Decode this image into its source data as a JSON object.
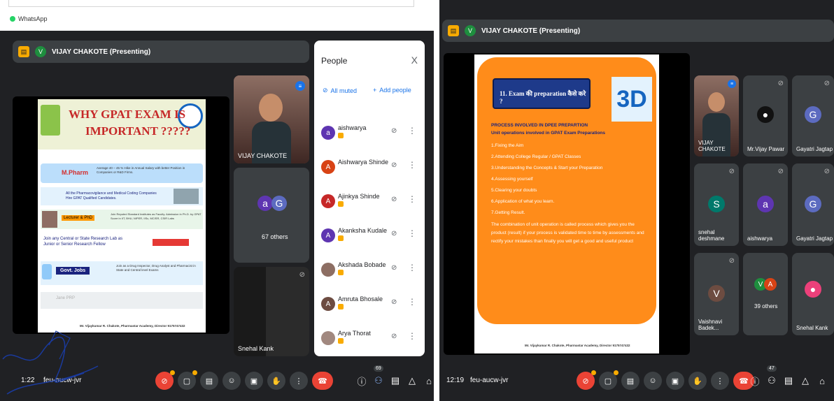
{
  "left": {
    "app": "WhatsApp",
    "presenting": "VIJAY CHAKOTE (Presenting)",
    "presenter_initial": "V",
    "slide": {
      "title_line1": "WHY GPAT EXAM IS",
      "title_line2": "IMPORTANT ?????",
      "mpharm_label": "M.Pharm",
      "mpharm_text": "Average 40 – 45 % Hike in Annual Salary with better Position in Companies or R&D Firms.",
      "pharmacovigilance": "All the Pharmacovigilance and Medical Coding Companies Hire GPAT Qualified Candidates.",
      "phd_label": "Lecturer & PhD",
      "phd_text": "Join Reputed Standard Institutes as Faculty. Admission in Ph.D. by GPAT Score in IIT, BHU, NIPER, IISc, MCISR, CSIR Labs",
      "research": "Join any Central or State Research Lab as Junior or Senior Research Fellow",
      "govt_label": "Govt. Jobs",
      "govt_text": "Join as a Drug Inspector, Drug Analyst and Pharmacist in State and Central level Exams",
      "faded": "Jane PRP",
      "footer": "Mr. Vijaykumar R. Chakote, Pharmastar Academy, Director 9175747432"
    },
    "presenter_tile_name": "VIJAY CHAKOTE",
    "others_label": "67 others",
    "others_avatars": [
      "a",
      "G"
    ],
    "snehal_tile": "Snehal Kank",
    "people": {
      "title": "People",
      "close": "X",
      "all_muted": "All muted",
      "add_people": "Add people",
      "list": [
        {
          "name": "aishwarya",
          "initial": "a",
          "color": "#5e35b1"
        },
        {
          "name": "Aishwarya Shinde",
          "initial": "A",
          "color": "#d84315"
        },
        {
          "name": "Ajinkya Shinde",
          "initial": "A",
          "color": "#c62828"
        },
        {
          "name": "Akanksha Kudale",
          "initial": "A",
          "color": "#5e35b1"
        },
        {
          "name": "Akshada Bobade",
          "initial": "",
          "color": "#8d6e63"
        },
        {
          "name": "Amruta Bhosale",
          "initial": "A",
          "color": "#6d4c41"
        },
        {
          "name": "Arya Thorat",
          "initial": "",
          "color": "#a1887f"
        }
      ]
    },
    "time": "1:22",
    "meeting_code": "feu-aucw-jvr",
    "participants_badge": "69"
  },
  "right": {
    "presenting": "VIJAY CHAKOTE (Presenting)",
    "presenter_initial": "V",
    "slide": {
      "heading": "11. Exam की preparation कैसे करे ?",
      "process_title": "PROCESS INVOLVED IN DPEE PREPARTION",
      "unit_ops": "Unit operations involved in GPAT Exam Preparations",
      "steps": [
        "1.Fixing the Aim",
        "2.Attending College Regular / GPAT Classes",
        "3.Understanding the Concepts & Start your Preparation",
        "4.Assessing yourself",
        "5.Clearing your doubts",
        "6.Application of what you learn.",
        "7.Getting Result."
      ],
      "summary": "The combination of unit operation is called process which gives you the product (result) if your process is validated time to time by assessments and rectify your mistakes than finally you will get a good and useful product",
      "footer": "Mr. Vijaykumar R. Chakote, Pharmastar Academy, Director 9175747432"
    },
    "tiles": [
      {
        "name": "VIJAY CHAKOTE",
        "initial": "",
        "color": "#3c4043"
      },
      {
        "name": "Mr.Vijay Pawar",
        "initial": "",
        "color": "#3c4043"
      },
      {
        "name": "Gayatri Jagtap",
        "initial": "G",
        "color": "#5c6bc0"
      },
      {
        "name": "snehal deshmane",
        "initial": "S",
        "color": "#00796b"
      },
      {
        "name": "aishwarya",
        "initial": "a",
        "color": "#5e35b1"
      },
      {
        "name": "Gayatri Jagtap",
        "initial": "G",
        "color": "#5c6bc0"
      },
      {
        "name": "Vaishnavi Badek...",
        "initial": "V",
        "color": "#6d4c41"
      },
      {
        "name": "39 others",
        "initial": "",
        "color": "#3c4043"
      },
      {
        "name": "Snehal Kank",
        "initial": "",
        "color": "#3c4043"
      }
    ],
    "others_avatars": [
      "V",
      "A"
    ],
    "time": "12:19",
    "meeting_code": "feu-aucw-jvr",
    "participants_badge": "47"
  }
}
